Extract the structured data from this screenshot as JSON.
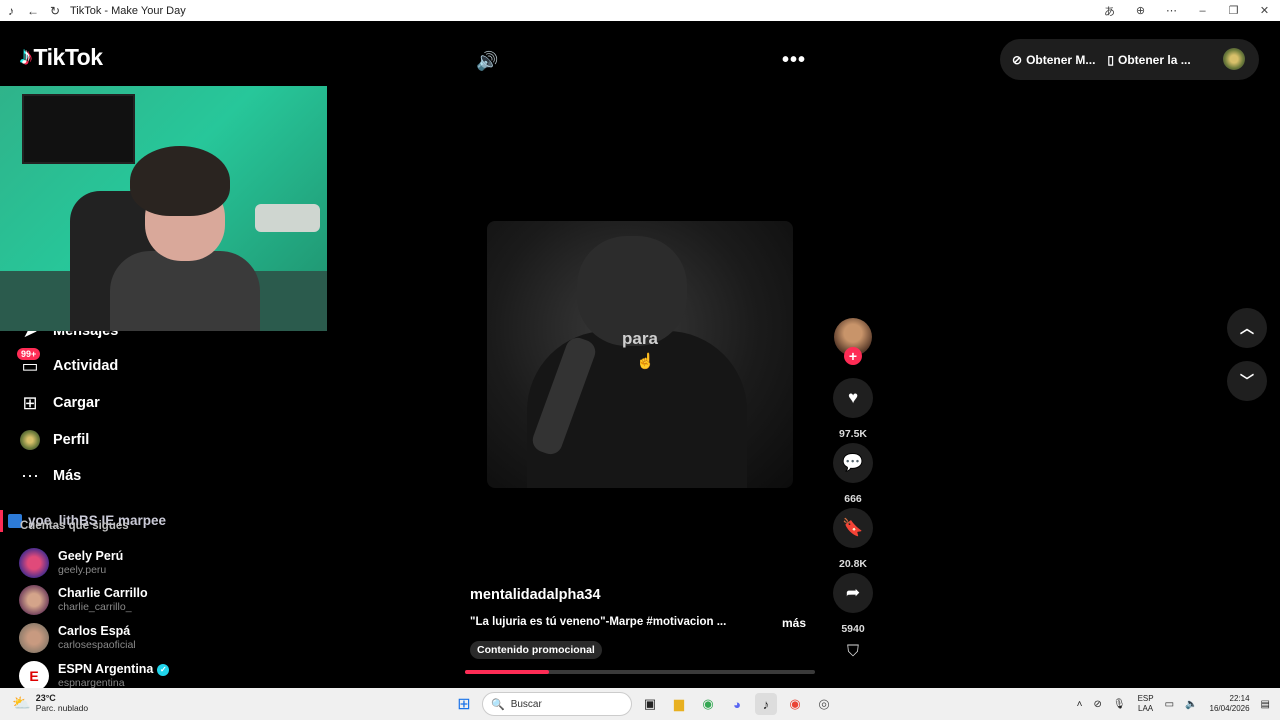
{
  "window": {
    "title": "TikTok - Make Your Day"
  },
  "app": {
    "logo_text": "TikTok"
  },
  "top": {
    "get_coins": "Obtener M...",
    "get_app": "Obtener la ..."
  },
  "nav": {
    "badge": "99+",
    "items": [
      {
        "label": "Mensajes",
        "icon": "send-icon"
      },
      {
        "label": "Actividad",
        "icon": "inbox-icon"
      },
      {
        "label": "Cargar",
        "icon": "plus-square-icon"
      },
      {
        "label": "Perfil",
        "icon": "avatar"
      },
      {
        "label": "Más",
        "icon": "ellipsis-icon"
      }
    ]
  },
  "live": {
    "text": "yoe_lithBS IE marpee"
  },
  "following": {
    "title": "Cuentas que sigues",
    "accounts": [
      {
        "name": "Geely Perú",
        "user": "geely.peru",
        "color": "#3b2a8f"
      },
      {
        "name": "Charlie Carrillo",
        "user": "charlie_carrillo_",
        "color": "#6b3a5a"
      },
      {
        "name": "Carlos Espá",
        "user": "carlosespaoficial",
        "color": "#8a7a6a"
      },
      {
        "name": "ESPN Argentina",
        "user": "espnargentina",
        "color": "#ffffff"
      }
    ]
  },
  "video": {
    "caption": "para",
    "author": "mentalidadalpha34",
    "description": "\"La lujuria es tú veneno\"-Marpe #motivacion ...",
    "more": "más",
    "promo": "Contenido promocional",
    "progress": 0.24
  },
  "actions": {
    "likes": "97.5K",
    "comments": "666",
    "saves": "20.8K",
    "shares": "5940"
  },
  "taskbar": {
    "temp": "23°C",
    "weather": "Parc. nublado",
    "search_placeholder": "Buscar",
    "lang_top": "ESP",
    "lang_bottom": "LAA",
    "time": "22:14",
    "date": "16/04/2026"
  },
  "colors": {
    "accent": "#fe2c55",
    "verified": "#20d5ec",
    "background": "#000000"
  }
}
